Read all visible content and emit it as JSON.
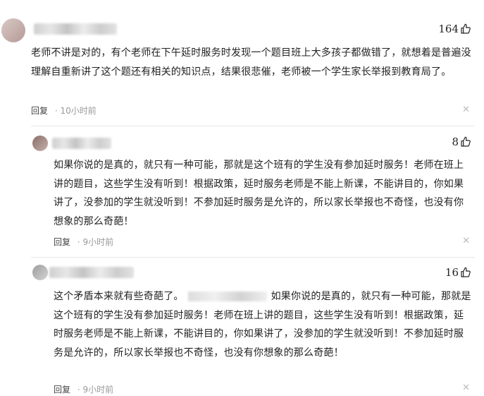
{
  "comments": [
    {
      "likes": "164",
      "text": "老师不讲是对的，有个老师在下午延时服务时发现一个题目班上大多孩子都做错了，就想着是普遍没理解自重新讲了这个题还有相关的知识点，结果很悲催，老师被一个学生家长举报到教育局了。",
      "reply_label": "回复",
      "time": "10小时前"
    },
    {
      "likes": "8",
      "text": "如果你说的是真的，就只有一种可能，那就是这个班有的学生没有参加延时服务！老师在班上讲的题目，这些学生没有听到！根据政策，延时服务老师是不能上新课，不能讲目的，你如果讲了，没参加的学生就没听到！不参加延时服务是允许的，所以家长举报也不奇怪，也没有你想象的那么奇葩！",
      "reply_label": "回复",
      "time": "9小时前"
    },
    {
      "likes": "16",
      "text_before": "这个矛盾本来就有些奇葩了。",
      "text_after": "如果你说的是真的，就只有一种可能，那就是这个班有的学生没有参加延时服务！老师在班上讲的题目，这些学生没有听到！根据政策，延时服务老师是不能上新课，不能讲目的，你如果讲了，没参加的学生就没听到！不参加延时服务是允许的，所以家长举报也不奇怪，也没有你想象的那么奇葩！",
      "reply_label": "回复",
      "time": "9小时前"
    }
  ],
  "icons": {
    "like": "thumbs-up-icon",
    "close": "close-icon"
  }
}
